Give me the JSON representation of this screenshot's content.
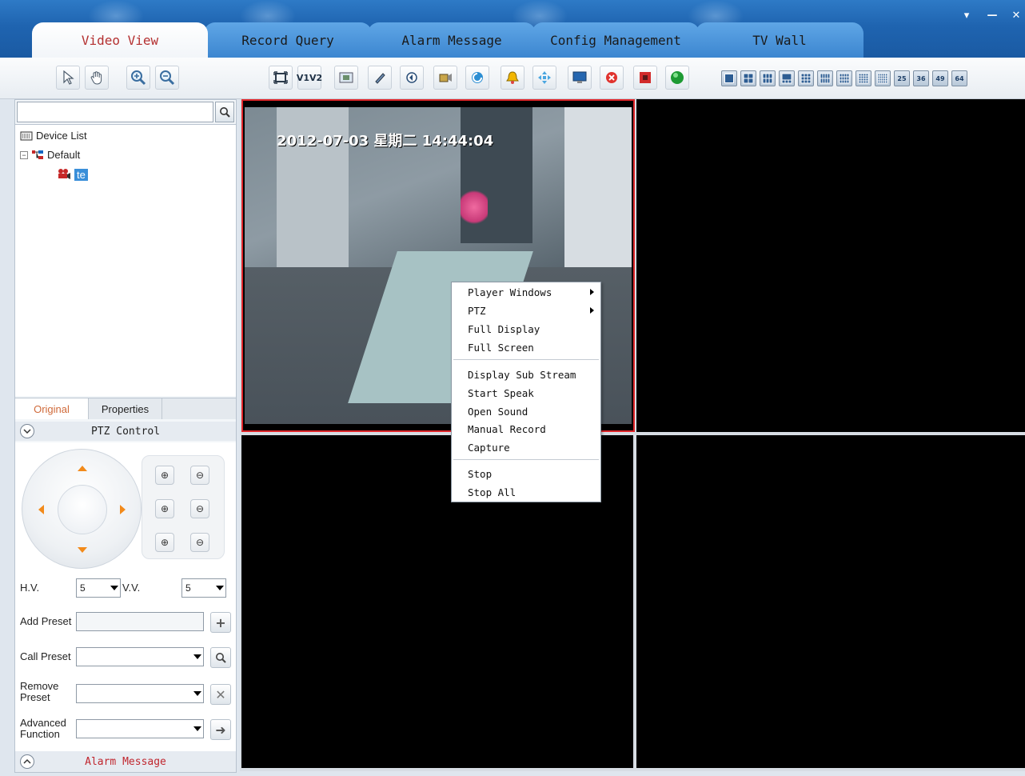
{
  "tabs": [
    "Video View",
    "Record Query",
    "Alarm Message",
    "Config Management",
    "TV Wall"
  ],
  "active_tab": "Video View",
  "window_controls": {
    "menu": "▾",
    "minimize": "—",
    "close": "✕"
  },
  "toolbar": {
    "left_tools": [
      "pointer-icon",
      "hand-icon",
      "zoom-in-icon",
      "zoom-out-icon"
    ],
    "v1v2_label": "V1V2",
    "grid_labels": [
      "25",
      "36",
      "49",
      "64"
    ]
  },
  "left_panel": {
    "search": {
      "value": ""
    },
    "tree": {
      "root": "Device List",
      "group": "Default",
      "device": "te"
    },
    "tabs": [
      "Original",
      "Properties"
    ],
    "ptz_title": "PTZ Control",
    "hv_label": "H.V.",
    "hv_value": "5",
    "vv_label": "V.V.",
    "vv_value": "5",
    "add_preset_label": "Add Preset",
    "call_preset_label": "Call Preset",
    "remove_preset_label_1": "Remove",
    "remove_preset_label_2": "Preset",
    "advanced_label_1": "Advanced",
    "advanced_label_2": "Function",
    "alarm_bar_label": "Alarm Message"
  },
  "video": {
    "osd_text": "2012-07-03 星期二 14:44:04"
  },
  "context_menu": {
    "group1": [
      "Player Windows",
      "PTZ",
      "Full Display",
      "Full Screen"
    ],
    "group2": [
      "Display Sub Stream",
      "Start Speak",
      "Open Sound",
      "Manual Record",
      "Capture"
    ],
    "group3": [
      "Stop",
      "Stop All"
    ]
  },
  "colors": {
    "title_bar": "#1f64b0",
    "active_tab_text": "#b43030",
    "selected_pane_border": "#e0262a",
    "alarm_text": "#c0262e",
    "tree_selection": "#3a8fd9"
  }
}
